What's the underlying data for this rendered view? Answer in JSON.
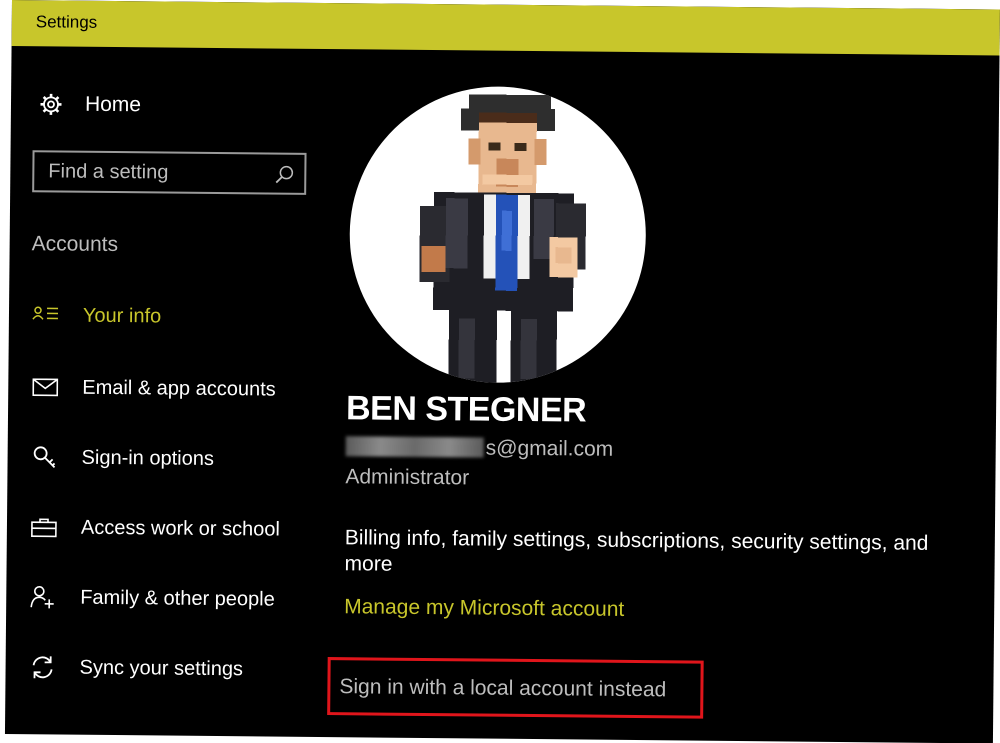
{
  "window": {
    "title": "Settings"
  },
  "nav": {
    "home_label": "Home",
    "search_placeholder": "Find a setting",
    "section_title": "Accounts",
    "items": [
      {
        "label": "Your info",
        "icon": "user-card-icon",
        "active": true
      },
      {
        "label": "Email & app accounts",
        "icon": "envelope-icon",
        "active": false
      },
      {
        "label": "Sign-in options",
        "icon": "key-icon",
        "active": false
      },
      {
        "label": "Access work or school",
        "icon": "briefcase-icon",
        "active": false
      },
      {
        "label": "Family & other people",
        "icon": "add-person-icon",
        "active": false
      },
      {
        "label": "Sync your settings",
        "icon": "sync-icon",
        "active": false
      }
    ]
  },
  "profile": {
    "name": "BEN STEGNER",
    "email_visible": "s@gmail.com",
    "role": "Administrator",
    "description": "Billing info, family settings, subscriptions, security settings, and more",
    "manage_link": "Manage my Microsoft account",
    "local_account_link": "Sign in with a local account instead"
  },
  "colors": {
    "accent": "#c8c62b",
    "background": "#000000",
    "highlight_box": "#e0151b"
  }
}
